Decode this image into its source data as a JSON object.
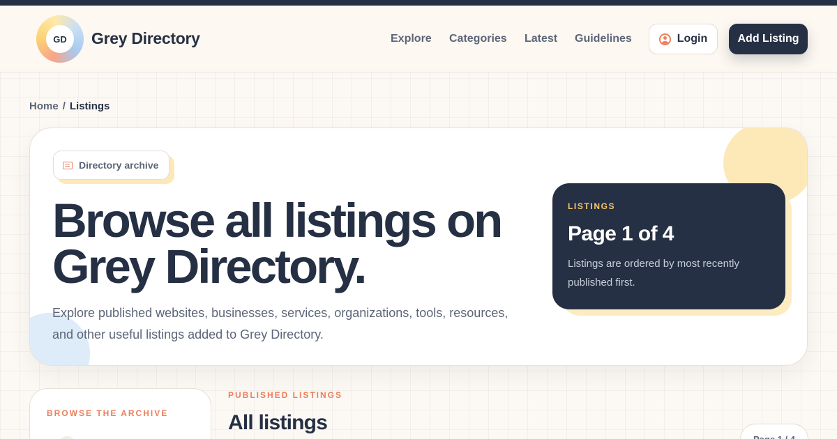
{
  "header": {
    "logo_initials": "GD",
    "brand": "Grey Directory",
    "nav": [
      "Explore",
      "Categories",
      "Latest",
      "Guidelines"
    ],
    "login_label": "Login",
    "add_listing_label": "Add Listing"
  },
  "breadcrumb": {
    "home": "Home",
    "separator": "/",
    "current": "Listings"
  },
  "hero": {
    "chip_label": "Directory archive",
    "title_line1": "Browse all listings on",
    "title_line2": "Grey Directory.",
    "description": "Explore published websites, businesses, services, organizations, tools, resources, and other useful listings added to Grey Directory."
  },
  "panel": {
    "eyebrow": "LISTINGS",
    "title": "Page 1 of 4",
    "text": "Listings are ordered by most recently published first."
  },
  "sidebar": {
    "eyebrow": "BROWSE THE ARCHIVE"
  },
  "section": {
    "eyebrow": "PUBLISHED LISTINGS",
    "title": "All listings",
    "page_pill": "Page 1 / 4"
  },
  "icons": {
    "login": "user-icon",
    "chip": "document-icon"
  },
  "colors": {
    "navy": "#263044",
    "accent_orange": "#ec7f5d",
    "accent_yellow": "#f8c66a",
    "background": "#fcf8f3"
  }
}
